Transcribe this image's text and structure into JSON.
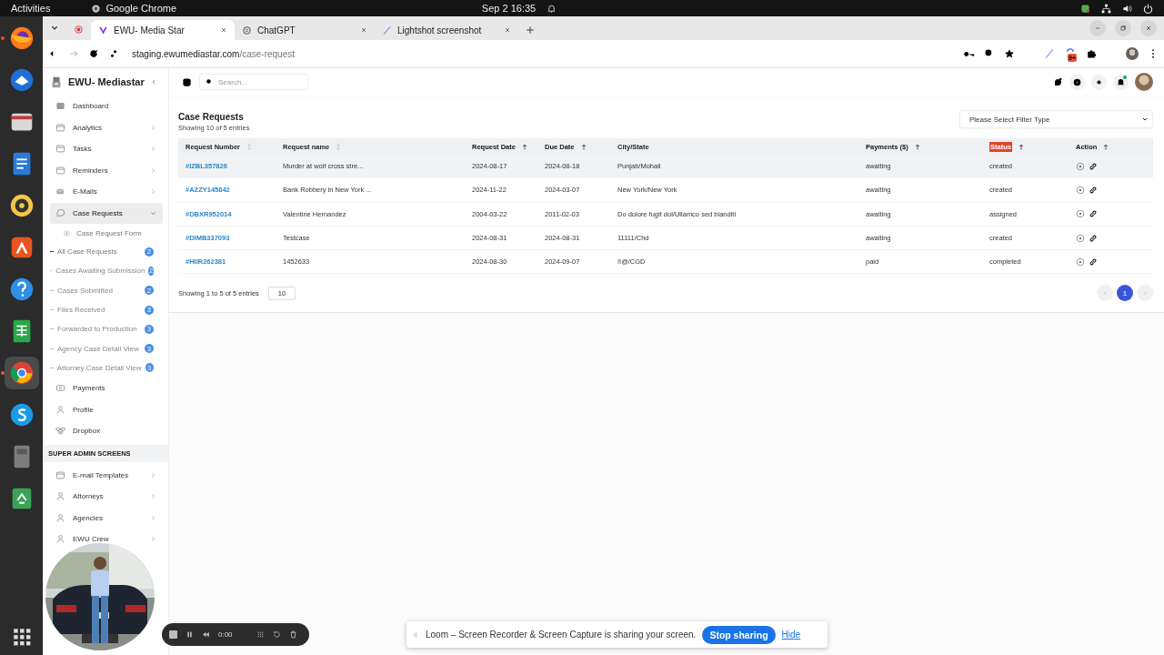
{
  "os_bar": {
    "activities": "Activities",
    "app": "Google Chrome",
    "clock": "Sep 2  16:35"
  },
  "dock": [
    {
      "running": true,
      "selected": false
    },
    {
      "running": false,
      "selected": false
    },
    {
      "running": false,
      "selected": false
    },
    {
      "running": false,
      "selected": false
    },
    {
      "running": false,
      "selected": false
    },
    {
      "running": false,
      "selected": false
    },
    {
      "running": false,
      "selected": false
    },
    {
      "running": false,
      "selected": false
    },
    {
      "running": true,
      "selected": true
    },
    {
      "running": false,
      "selected": false
    },
    {
      "running": false,
      "selected": false
    },
    {
      "running": false,
      "selected": false
    }
  ],
  "tabs": [
    {
      "title": "EWU- Media Star",
      "selected": true
    },
    {
      "title": "ChatGPT",
      "selected": false
    },
    {
      "title": "Lightshot screenshot",
      "selected": false
    }
  ],
  "address": {
    "host": "staging.ewumediastar.com",
    "path": "/case-request"
  },
  "extension_badge": "9+",
  "sidebar": {
    "brand": "EWU- Mediastar",
    "items": [
      {
        "kind": "link",
        "label": "Dashboard",
        "selected": false,
        "submenu": false,
        "expanded": false
      },
      {
        "kind": "link",
        "label": "Analytics",
        "selected": false,
        "submenu": true,
        "expanded": false
      },
      {
        "kind": "link",
        "label": "Tasks",
        "selected": false,
        "submenu": true,
        "expanded": false
      },
      {
        "kind": "link",
        "label": "Reminders",
        "selected": false,
        "submenu": true,
        "expanded": false
      },
      {
        "kind": "link",
        "label": "E-Mails",
        "selected": false,
        "submenu": true,
        "expanded": false
      },
      {
        "kind": "link",
        "label": "Case Requests",
        "selected": true,
        "submenu": true,
        "expanded": true
      },
      {
        "kind": "sub",
        "label": "Case Request Form"
      },
      {
        "kind": "dash",
        "label": "All Case Requests",
        "count": "2",
        "selected": true
      },
      {
        "kind": "dash",
        "label": "Cases Awaiting Submission",
        "count": "2",
        "selected": false
      },
      {
        "kind": "dash",
        "label": "Cases Submitted",
        "count": "2",
        "selected": false
      },
      {
        "kind": "dash",
        "label": "Files Received",
        "count": "3",
        "selected": false
      },
      {
        "kind": "dash",
        "label": "Forwarded to Production",
        "count": "3",
        "selected": false
      },
      {
        "kind": "dash",
        "label": "Agency Case Detail View",
        "count": "3",
        "selected": false
      },
      {
        "kind": "dash",
        "label": "Attorney Case Detail View",
        "count": "3",
        "selected": false
      },
      {
        "kind": "link",
        "label": "Payments",
        "selected": false,
        "submenu": false,
        "expanded": false
      },
      {
        "kind": "link",
        "label": "Profile",
        "selected": false,
        "submenu": false,
        "expanded": false
      },
      {
        "kind": "link",
        "label": "Dropbox",
        "selected": false,
        "submenu": false,
        "expanded": false
      },
      {
        "kind": "section",
        "label": "SUPER ADMIN SCREENS"
      },
      {
        "kind": "link",
        "label": "E-mail Templates",
        "selected": false,
        "submenu": true,
        "expanded": false
      },
      {
        "kind": "link",
        "label": "Attorneys",
        "selected": false,
        "submenu": true,
        "expanded": false
      },
      {
        "kind": "link",
        "label": "Agencies",
        "selected": false,
        "submenu": true,
        "expanded": false
      },
      {
        "kind": "link",
        "label": "EWU Crew",
        "selected": false,
        "submenu": true,
        "expanded": false
      }
    ]
  },
  "search": {
    "placeholder": "Search..."
  },
  "page": {
    "title": "Case Requests",
    "subtitle": "Showing 10 of 5 entries",
    "filter": {
      "placeholder": "Please Select Filter Type"
    }
  },
  "table": {
    "columns": [
      {
        "label": "Request Number",
        "sortable": true,
        "sorted": false,
        "highlighted": false
      },
      {
        "label": "Request name",
        "sortable": true,
        "sorted": false,
        "highlighted": false
      },
      {
        "label": "Request Date",
        "sortable": true,
        "sorted": true,
        "highlighted": false
      },
      {
        "label": "Due Date",
        "sortable": true,
        "sorted": true,
        "highlighted": false
      },
      {
        "label": "City/State",
        "sortable": false,
        "sorted": false,
        "highlighted": false
      },
      {
        "label": "Payments ($)",
        "sortable": true,
        "sorted": true,
        "highlighted": false
      },
      {
        "label": "Status",
        "sortable": true,
        "sorted": true,
        "highlighted": true
      },
      {
        "label": "Action",
        "sortable": true,
        "sorted": true,
        "highlighted": false
      }
    ],
    "rows": [
      {
        "number": "#IZBL357826",
        "name": "Murder at wolf cross stre...",
        "request_date": "2024-08-17",
        "due_date": "2024-08-18",
        "city_state": "Punjab/Mohali",
        "payment": "awaiting",
        "status": "created",
        "highlighted": true
      },
      {
        "number": "#AZZY145842",
        "name": "Bank Robbery in New York ...",
        "request_date": "2024-11-22",
        "due_date": "2024-03-07",
        "city_state": "New York/New York",
        "payment": "awaiting",
        "status": "created",
        "highlighted": false
      },
      {
        "number": "#DBXR952014",
        "name": "Valentine Hernandez",
        "request_date": "2004-03-22",
        "due_date": "2011-02-03",
        "city_state": "Do dolore fugit dol/Ullamco sed blanditi",
        "payment": "awaiting",
        "status": "assigned",
        "highlighted": false
      },
      {
        "number": "#DIMB337093",
        "name": "Testcase",
        "request_date": "2024-08-31",
        "due_date": "2024-08-31",
        "city_state": "11111/Chd",
        "payment": "awaiting",
        "status": "created",
        "highlighted": false
      },
      {
        "number": "#HIIR262381",
        "name": "1452633",
        "request_date": "2024-08-30",
        "due_date": "2024-09-07",
        "city_state": "!!@/CGD",
        "payment": "paid",
        "status": "completed",
        "highlighted": false
      }
    ]
  },
  "footer": {
    "summary": "Showing 1 to 5 of 5 entries",
    "page_size": "10",
    "pages": [
      {
        "label": "1",
        "selected": true
      }
    ]
  },
  "recorder": {
    "time": "0:00"
  },
  "share_banner": {
    "message": "Loom – Screen Recorder & Screen Capture is sharing your screen.",
    "stop": "Stop sharing",
    "hide": "Hide"
  }
}
